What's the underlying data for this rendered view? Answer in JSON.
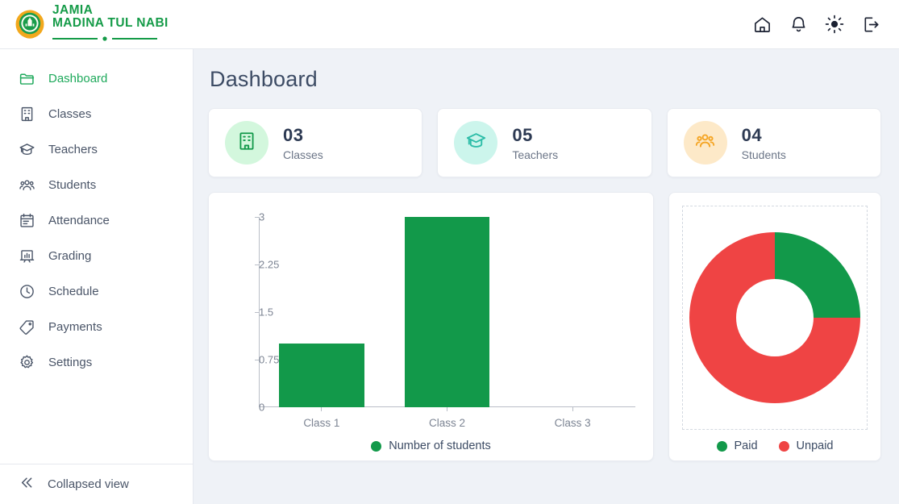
{
  "brand": {
    "line1": "JAMIA",
    "line2": "MADINA TUL NABI",
    "logo_icon": "mosque-emblem-icon",
    "color": "#159B48"
  },
  "header": {
    "actions": [
      {
        "name": "home-icon",
        "label": "Home"
      },
      {
        "name": "bell-icon",
        "label": "Notifications"
      },
      {
        "name": "sun-icon",
        "label": "Theme"
      },
      {
        "name": "logout-icon",
        "label": "Logout"
      }
    ]
  },
  "sidebar": {
    "items": [
      {
        "label": "Dashboard",
        "icon": "folder-icon",
        "active": true
      },
      {
        "label": "Classes",
        "icon": "building-icon",
        "active": false
      },
      {
        "label": "Teachers",
        "icon": "graduation-cap-icon",
        "active": false
      },
      {
        "label": "Students",
        "icon": "users-icon",
        "active": false
      },
      {
        "label": "Attendance",
        "icon": "calendar-icon",
        "active": false
      },
      {
        "label": "Grading",
        "icon": "chart-bar-icon",
        "active": false
      },
      {
        "label": "Schedule",
        "icon": "clock-icon",
        "active": false
      },
      {
        "label": "Payments",
        "icon": "tag-icon",
        "active": false
      },
      {
        "label": "Settings",
        "icon": "gear-icon",
        "active": false
      }
    ],
    "footer": {
      "label": "Collapsed view",
      "icon": "chevrons-left-icon"
    },
    "active_color": "#1ea95b"
  },
  "main": {
    "title": "Dashboard",
    "stats": [
      {
        "value": "03",
        "label": "Classes",
        "icon": "building-icon",
        "icon_color": "#12994a",
        "badge_color": "#d3f7dd"
      },
      {
        "value": "05",
        "label": "Teachers",
        "icon": "graduation-cap-icon",
        "icon_color": "#2dbda8",
        "badge_color": "#ccf5ec"
      },
      {
        "value": "04",
        "label": "Students",
        "icon": "users-icon",
        "icon_color": "#f5a524",
        "badge_color": "#fde9c8"
      }
    ]
  },
  "chart_data": [
    {
      "type": "bar",
      "title": "",
      "categories": [
        "Class 1",
        "Class 2",
        "Class 3"
      ],
      "values": [
        1,
        3,
        0
      ],
      "series": [
        {
          "name": "Number of students",
          "values": [
            1,
            3,
            0
          ],
          "color": "#12994a"
        }
      ],
      "xlabel": "",
      "ylabel": "",
      "ylim": [
        0,
        3
      ],
      "yticks": [
        "0",
        "0.75",
        "1.5",
        "2.25",
        "3"
      ],
      "ytick_values": [
        0,
        0.75,
        1.5,
        2.25,
        3
      ],
      "grid": false,
      "legend": [
        {
          "label": "Number of students",
          "color": "#12994a"
        }
      ],
      "legend_position": "bottom"
    },
    {
      "type": "pie",
      "variant": "donut",
      "title": "",
      "categories": [
        "Paid",
        "Unpaid"
      ],
      "values": [
        1,
        3
      ],
      "percentages": [
        25,
        75
      ],
      "colors": [
        "#12994a",
        "#ef4444"
      ],
      "legend": [
        {
          "label": "Paid",
          "color": "#12994a"
        },
        {
          "label": "Unpaid",
          "color": "#ef4444"
        }
      ],
      "legend_position": "bottom"
    }
  ]
}
